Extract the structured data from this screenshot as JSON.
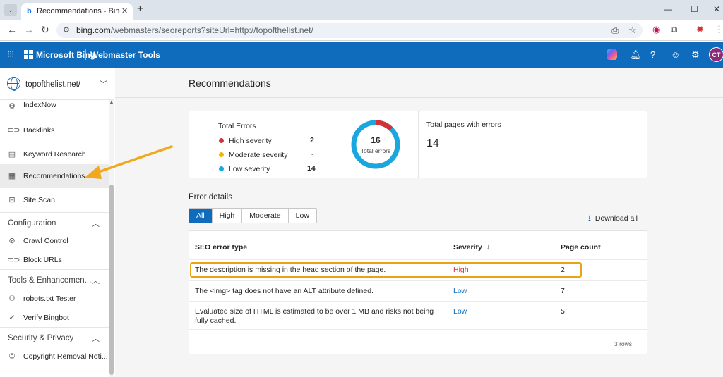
{
  "browser": {
    "tab_title": "Recommendations - Bing Webmaster Tools",
    "url_host": "bing.com",
    "url_path": "/webmasters/seoreports?siteUrl=http://topofthelist.net/"
  },
  "header": {
    "brand": "Microsoft Bing",
    "product": "Webmaster Tools",
    "avatar_initials": "CT"
  },
  "sidebar": {
    "site": "topofthelist.net/",
    "items": [
      {
        "label": "IndexNow",
        "icon": "gear-icon"
      },
      {
        "label": "Backlinks",
        "icon": "link-icon"
      },
      {
        "label": "Keyword Research",
        "icon": "document-icon"
      },
      {
        "label": "Recommendations",
        "icon": "checklist-icon"
      },
      {
        "label": "Site Scan",
        "icon": "scan-icon"
      }
    ],
    "sections": [
      {
        "label": "Configuration",
        "items": [
          "Crawl Control",
          "Block URLs"
        ]
      },
      {
        "label": "Tools & Enhancemen...",
        "items": [
          "robots.txt Tester",
          "Verify Bingbot"
        ]
      },
      {
        "label": "Security & Privacy",
        "items": [
          "Copyright Removal Noti..."
        ]
      }
    ]
  },
  "main": {
    "title": "Recommendations",
    "total_errors": {
      "label": "Total Errors",
      "high_label": "High severity",
      "high_value": "2",
      "moderate_label": "Moderate severity",
      "moderate_value": "-",
      "low_label": "Low severity",
      "low_value": "14",
      "donut_total": "16",
      "donut_label": "Total errors"
    },
    "pages_with_errors": {
      "label": "Total pages with errors",
      "value": "14"
    },
    "error_details_title": "Error details",
    "filters": [
      "All",
      "High",
      "Moderate",
      "Low"
    ],
    "download_label": "Download all",
    "table": {
      "col_error": "SEO error type",
      "col_severity": "Severity",
      "col_pages": "Page count",
      "rows": [
        {
          "error": "The description is missing in the head section of the page.",
          "severity": "High",
          "pages": "2"
        },
        {
          "error": "The <img> tag does not have an ALT attribute defined.",
          "severity": "Low",
          "pages": "7"
        },
        {
          "error": "Evaluated size of HTML is estimated to be over 1 MB and risks not being fully cached.",
          "severity": "Low",
          "pages": "5"
        }
      ],
      "row_count": "3 rows"
    }
  },
  "colors": {
    "accent": "#0f6cbd",
    "high": "#d13438",
    "moderate": "#f7b500",
    "low": "#1aa7e0",
    "highlight": "#e8a317"
  }
}
